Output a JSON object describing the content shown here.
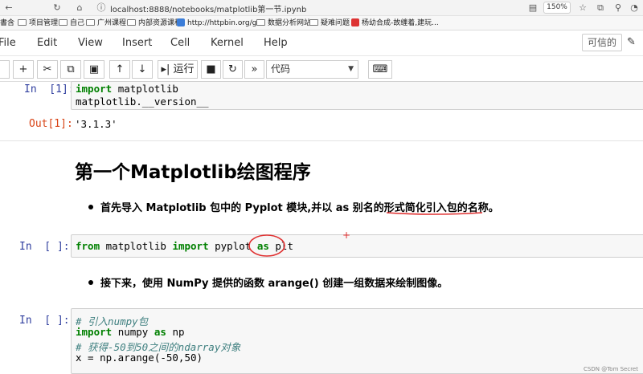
{
  "browser": {
    "url": "localhost:8888/notebooks/matplotlib第一节.ipynb",
    "zoom": "150%",
    "bookmarks": [
      "書含",
      "项目管理",
      "自己",
      "广州课程",
      "内部资源课程",
      "http://httpbin.org/get",
      "数据分析网站",
      "疑难问题",
      "杨幼合成-故缠着,建玩..."
    ]
  },
  "menu": {
    "items": [
      "File",
      "Edit",
      "View",
      "Insert",
      "Cell",
      "Kernel",
      "Help"
    ],
    "trusted": "可信的"
  },
  "toolbar": {
    "run_label": "运行",
    "cell_type": "代码"
  },
  "cells": {
    "c1": {
      "prompt": "In  [1]:",
      "lines": [
        "import matplotlib",
        "matplotlib.__version__"
      ],
      "out_prompt": "Out[1]:",
      "output": "'3.1.3'"
    },
    "heading": "第一个Matplotlib绘图程序",
    "bullet1": "首先导入 Matplotlib 包中的 Pyplot 模块,并以 as 别名的形式简化引入包的名称。",
    "c2": {
      "prompt": "In  [ ]:",
      "line": "from matplotlib import pyplot as plt"
    },
    "bullet2": "接下来，使用 NumPy 提供的函数 arange() 创建一组数据来绘制图像。",
    "c3": {
      "prompt": "In  [ ]:",
      "lines": [
        "# 引入numpy包",
        "import numpy as np",
        "# 获得-50到50之间的ndarray对象",
        "x = np.arange(-50,50)"
      ]
    }
  },
  "watermark": "CSDN @Tom Secret",
  "colors": {
    "annotation_red": "#e03030",
    "in_prompt": "#303f9f",
    "out_prompt": "#d84315",
    "keyword": "#008000"
  }
}
